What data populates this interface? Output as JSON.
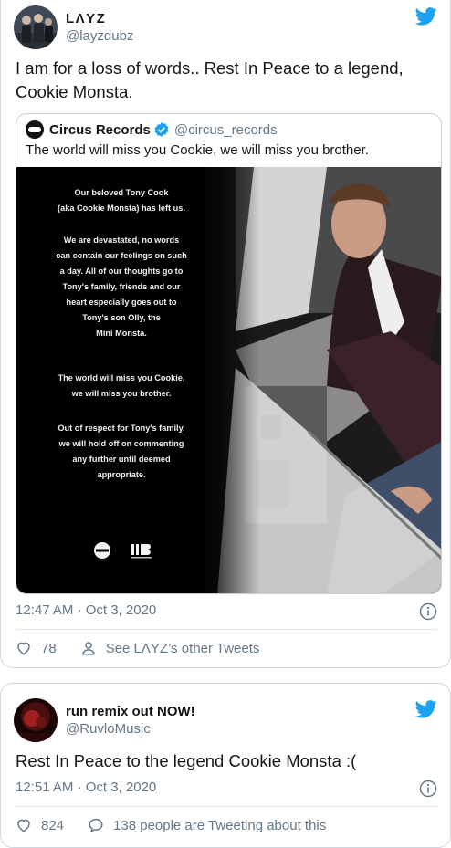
{
  "tweet1": {
    "display_name": "LΛYZ",
    "handle": "@layzdubz",
    "text": "I am for a loss of words.. Rest In Peace to a legend, Cookie Monsta.",
    "quoted": {
      "display_name": "Circus Records",
      "handle": "@circus_records",
      "text": "The world will miss you Cookie, we will miss you brother.",
      "statement": [
        "Our beloved Tony Cook",
        "(aka Cookie Monsta) has left us.",
        "We are devastated, no words",
        "can contain our feelings on such",
        "a day. All of our thoughts go to",
        "Tony's family, friends and our",
        "heart especially goes out to",
        "Tony's son Olly, the",
        "Mini Monsta.",
        "The world will miss you Cookie,",
        "we will miss you brother.",
        "Out of respect for Tony's family,",
        "we will hold off on commenting",
        "any further until deemed",
        "appropriate."
      ]
    },
    "timestamp": "12:47 AM · Oct 3, 2020",
    "likes": "78",
    "other_tweets": "See LΛYZ’s other Tweets"
  },
  "tweet2": {
    "display_name": "run remix out NOW!",
    "handle": "@RuvloMusic",
    "text": "Rest In Peace to the legend Cookie Monsta :(",
    "timestamp": "12:51 AM · Oct 3, 2020",
    "likes": "824",
    "tweeting": "138 people are Tweeting about this"
  },
  "colors": {
    "twitter_blue": "#1da1f2",
    "secondary_text": "#657786",
    "border": "#d0d7de"
  },
  "icons": [
    "twitter-bird-icon",
    "verified-badge-icon",
    "info-icon",
    "heart-icon",
    "person-icon",
    "speech-bubble-icon"
  ]
}
